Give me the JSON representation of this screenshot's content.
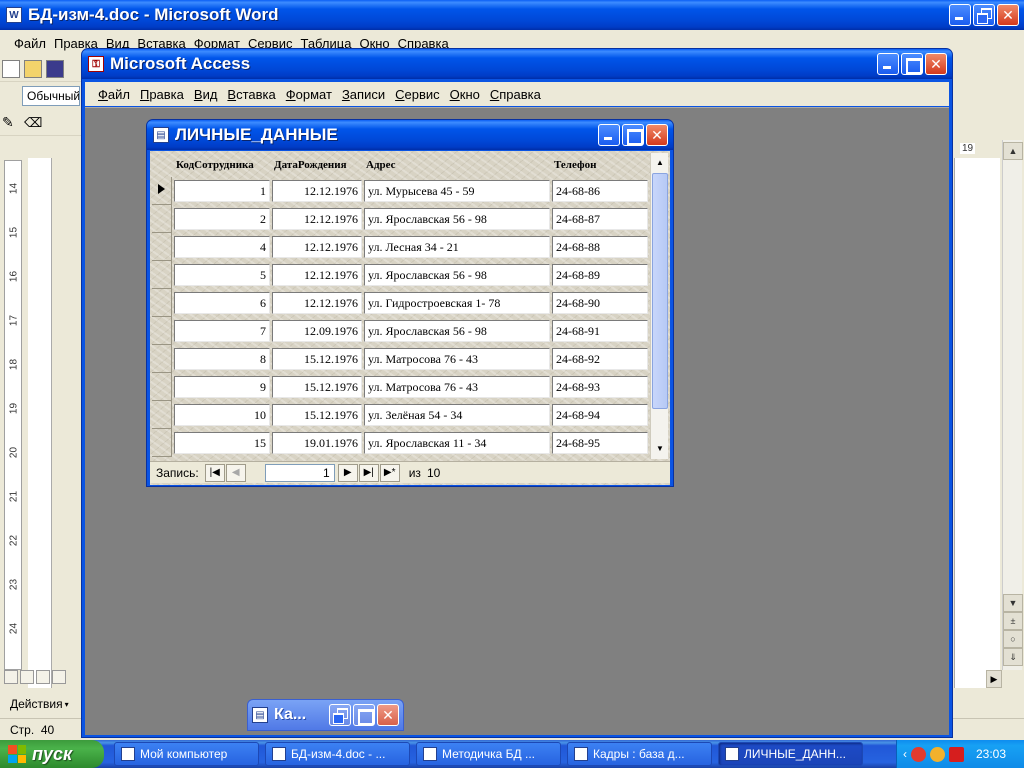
{
  "word": {
    "title": "БД-изм-4.doc - Microsoft Word",
    "icon_letter": "W",
    "menu": [
      "Файл",
      "Правка",
      "Вид",
      "Вставка",
      "Формат",
      "Сервис",
      "Таблица",
      "Окно",
      "Справка"
    ],
    "style_box": "Обычный",
    "status_page": "Стр.  40",
    "draw_label": "Действия",
    "ruler_right_num": "19",
    "vruler_nums": [
      "14",
      "15",
      "16",
      "17",
      "18",
      "19",
      "20",
      "21",
      "22",
      "23",
      "24"
    ]
  },
  "access": {
    "title": "Microsoft Access",
    "menu": [
      "Файл",
      "Правка",
      "Вид",
      "Вставка",
      "Формат",
      "Записи",
      "Сервис",
      "Окно",
      "Справка"
    ]
  },
  "form": {
    "title": "ЛИЧНЫЕ_ДАННЫЕ",
    "headers": {
      "id": "КодСотрудника",
      "dob": "ДатаРождения",
      "addr": "Адрес",
      "tel": "Телефон"
    },
    "rows": [
      {
        "id": "1",
        "dob": "12.12.1976",
        "addr": "ул. Мурысева 45 - 59",
        "tel": "24-68-86"
      },
      {
        "id": "2",
        "dob": "12.12.1976",
        "addr": "ул. Ярославская 56 - 98",
        "tel": "24-68-87"
      },
      {
        "id": "4",
        "dob": "12.12.1976",
        "addr": "ул. Лесная 34 - 21",
        "tel": "24-68-88"
      },
      {
        "id": "5",
        "dob": "12.12.1976",
        "addr": "ул. Ярославская 56 - 98",
        "tel": "24-68-89"
      },
      {
        "id": "6",
        "dob": "12.12.1976",
        "addr": "ул. Гидростроевская 1- 78",
        "tel": "24-68-90"
      },
      {
        "id": "7",
        "dob": "12.09.1976",
        "addr": "ул. Ярославская 56 - 98",
        "tel": "24-68-91"
      },
      {
        "id": "8",
        "dob": "15.12.1976",
        "addr": "ул. Матросова 76 - 43",
        "tel": "24-68-92"
      },
      {
        "id": "9",
        "dob": "15.12.1976",
        "addr": "ул. Матросова 76 - 43",
        "tel": "24-68-93"
      },
      {
        "id": "10",
        "dob": "15.12.1976",
        "addr": "ул. Зелёная 54 - 34",
        "tel": "24-68-94"
      },
      {
        "id": "15",
        "dob": "19.01.1976",
        "addr": "ул. Ярославская 11 - 34",
        "tel": "24-68-95"
      }
    ],
    "nav": {
      "label": "Запись:",
      "current": "1",
      "of_label": "из",
      "total": "10"
    }
  },
  "minimized": {
    "title": "Ка..."
  },
  "taskbar": {
    "start": "пуск",
    "tasks": [
      "Мой компьютер",
      "БД-изм-4.doc - ...",
      "Методичка БД ...",
      "Кадры : база д...",
      "ЛИЧНЫЕ_ДАНН..."
    ],
    "active_index": 4,
    "clock": "23:03"
  }
}
